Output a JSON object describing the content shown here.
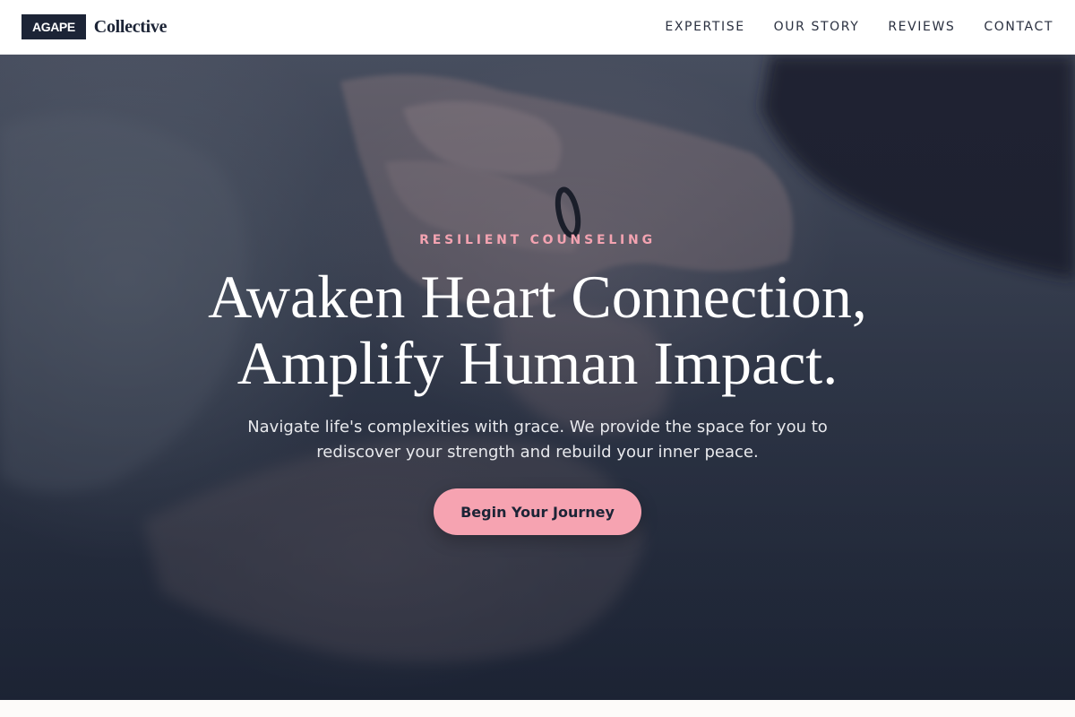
{
  "brand": {
    "mark": "AGAPE",
    "word": "Collective"
  },
  "nav": {
    "items": [
      {
        "label": "EXPERTISE"
      },
      {
        "label": "OUR STORY"
      },
      {
        "label": "REVIEWS"
      },
      {
        "label": "CONTACT"
      }
    ]
  },
  "hero": {
    "eyebrow": "RESILIENT COUNSELING",
    "headline_line1": "Awaken Heart Connection,",
    "headline_line2": "Amplify Human Impact.",
    "subtext_line1": "Navigate life's complexities with grace. We provide the space for you to",
    "subtext_line2": "rediscover your strength and rebuild your inner peace.",
    "cta_label": "Begin Your Journey",
    "background_description_icon": "clasped-hands-photo"
  },
  "colors": {
    "brand_dark": "#1c2436",
    "accent_pink": "#f6a3b1",
    "eyebrow_pink": "#f3a3b1",
    "nav_text": "#2a3040"
  }
}
